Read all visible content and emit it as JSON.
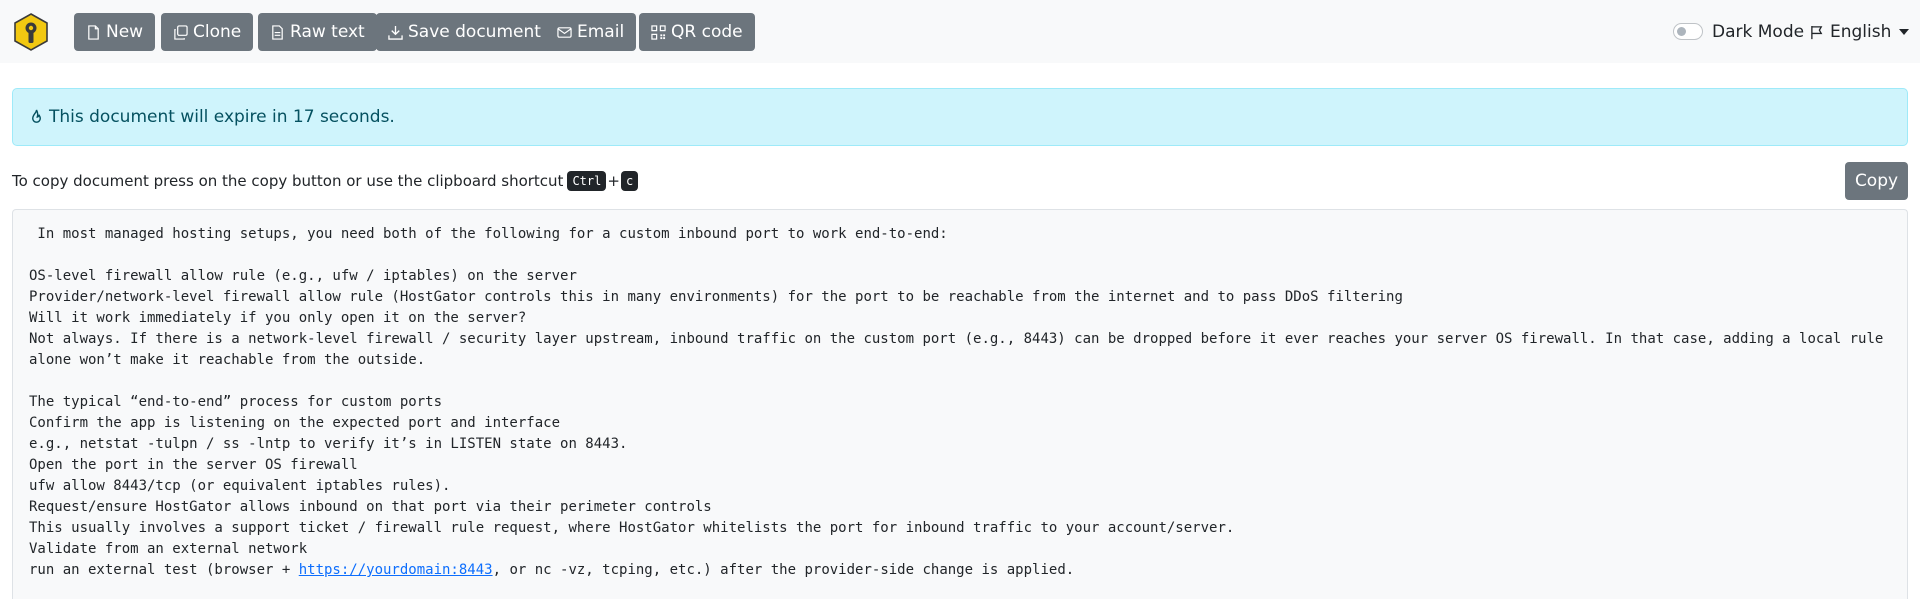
{
  "navbar": {
    "logo_icon": "keyhole-shield-icon",
    "buttons": {
      "new": "New",
      "clone": "Clone",
      "raw_text": "Raw text",
      "save_document": "Save document",
      "email": "Email",
      "qr_code": "QR code"
    },
    "dark_mode_label": "Dark Mode",
    "dark_mode_enabled": false,
    "language": "English"
  },
  "alert": {
    "icon": "fire-icon",
    "message": "This document will expire in 17 seconds."
  },
  "copy_section": {
    "instruction": "To copy document press on the copy button or use the clipboard shortcut",
    "shortcut_key1": "Ctrl",
    "shortcut_plus": "+",
    "shortcut_key2": "c",
    "copy_button": "Copy"
  },
  "document": {
    "lines": [
      " In most managed hosting setups, you need both of the following for a custom inbound port to work end-to-end:",
      "",
      "OS-level firewall allow rule (e.g., ufw / iptables) on the server",
      "Provider/network-level firewall allow rule (HostGator controls this in many environments) for the port to be reachable from the internet and to pass DDoS filtering",
      "Will it work immediately if you only open it on the server?",
      "Not always. If there is a network-level firewall / security layer upstream, inbound traffic on the custom port (e.g., 8443) can be dropped before it ever reaches your server OS firewall. In that case, adding a local rule alone won’t make it reachable from the outside.",
      "",
      "The typical “end-to-end” process for custom ports",
      "Confirm the app is listening on the expected port and interface",
      "e.g., netstat -tulpn / ss -lntp to verify it’s in LISTEN state on 8443.",
      "Open the port in the server OS firewall",
      "ufw allow 8443/tcp (or equivalent iptables rules).",
      "Request/ensure HostGator allows inbound on that port via their perimeter controls",
      "This usually involves a support ticket / firewall rule request, where HostGator whitelists the port for inbound traffic to your account/server.",
      "Validate from an external network"
    ],
    "last_line": {
      "before": "run an external test (browser + ",
      "link": "https://yourdomain:8443",
      "after": ", or nc -vz, tcping, etc.) after the provider-side change is applied."
    }
  }
}
